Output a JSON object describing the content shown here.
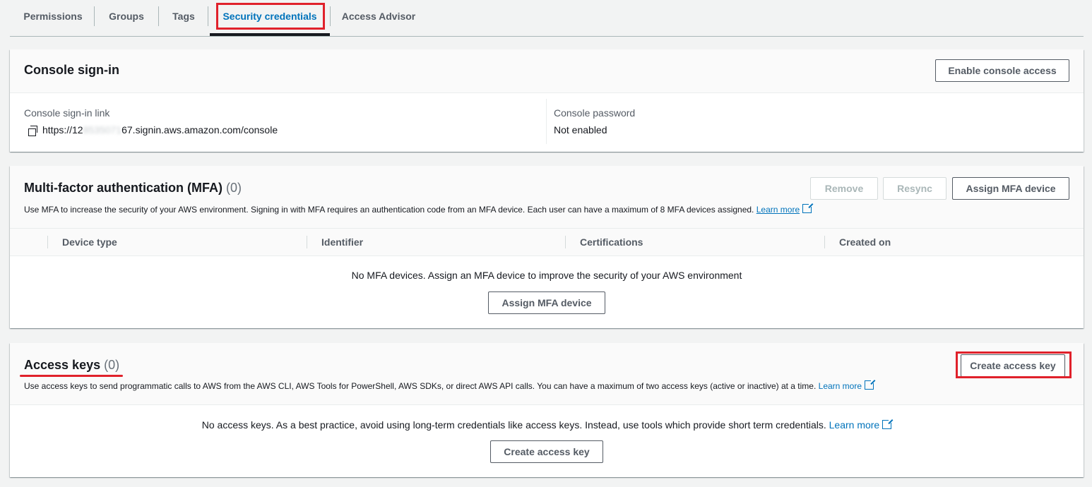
{
  "tabs": [
    {
      "label": "Permissions"
    },
    {
      "label": "Groups"
    },
    {
      "label": "Tags"
    },
    {
      "label": "Security credentials"
    },
    {
      "label": "Access Advisor"
    }
  ],
  "console_signin": {
    "title": "Console sign-in",
    "enable_button": "Enable console access",
    "link_label": "Console sign-in link",
    "link_prefix": "https://12",
    "link_redacted": "8535071",
    "link_suffix": "67.signin.aws.amazon.com/console",
    "password_label": "Console password",
    "password_value": "Not enabled"
  },
  "mfa": {
    "title": "Multi-factor authentication (MFA)",
    "count": "(0)",
    "remove_button": "Remove",
    "resync_button": "Resync",
    "assign_button": "Assign MFA device",
    "description": "Use MFA to increase the security of your AWS environment. Signing in with MFA requires an authentication code from an MFA device. Each user can have a maximum of 8 MFA devices assigned.",
    "learn_more": "Learn more",
    "columns": [
      "Device type",
      "Identifier",
      "Certifications",
      "Created on"
    ],
    "empty_text": "No MFA devices. Assign an MFA device to improve the security of your AWS environment",
    "empty_button": "Assign MFA device"
  },
  "access_keys": {
    "title": "Access keys",
    "count": "(0)",
    "create_button": "Create access key",
    "description": "Use access keys to send programmatic calls to AWS from the AWS CLI, AWS Tools for PowerShell, AWS SDKs, or direct AWS API calls. You can have a maximum of two access keys (active or inactive) at a time.",
    "learn_more": "Learn more",
    "empty_text": "No access keys. As a best practice, avoid using long-term credentials like access keys. Instead, use tools which provide short term credentials.",
    "empty_learn_more": "Learn more",
    "empty_button": "Create access key"
  },
  "colors": {
    "accent": "#0073bb",
    "highlight": "#e0212b"
  },
  "icons": [
    "copy-icon",
    "external-link-icon"
  ]
}
